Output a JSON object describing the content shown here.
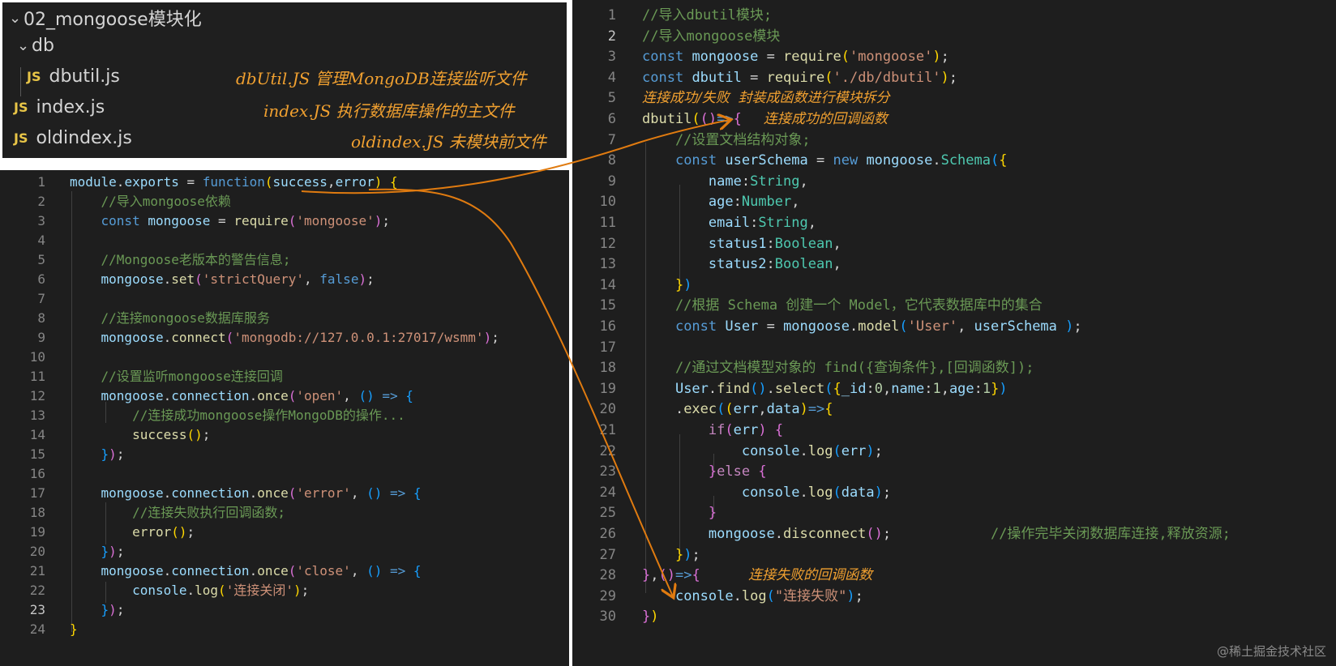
{
  "explorer": {
    "root": "02_mongoose模块化",
    "folder": "db",
    "files": [
      {
        "badge": "JS",
        "name": "dbutil.js",
        "note": "dbUtil.JS 管理MongoDB连接监听文件"
      },
      {
        "badge": "JS",
        "name": "index.js",
        "note": "index.JS  执行数据库操作的主文件"
      },
      {
        "badge": "JS",
        "name": "oldindex.js",
        "note": "oldindex.JS 未模块前文件"
      }
    ]
  },
  "left_editor": {
    "line_numbers": [
      "1",
      "2",
      "3",
      "4",
      "5",
      "6",
      "7",
      "8",
      "9",
      "10",
      "11",
      "12",
      "13",
      "14",
      "15",
      "16",
      "17",
      "18",
      "19",
      "20",
      "21",
      "22",
      "23",
      "24"
    ],
    "active_line": 23,
    "lines": [
      [
        [
          "module",
          "var"
        ],
        [
          ".",
          "pn"
        ],
        [
          "exports",
          "var"
        ],
        [
          " = ",
          "pn"
        ],
        [
          "function",
          "kw"
        ],
        [
          "(",
          "b1"
        ],
        [
          "success",
          "var"
        ],
        [
          ",",
          "pn"
        ],
        [
          "error",
          "var"
        ],
        [
          ")",
          "b1"
        ],
        [
          " ",
          "pn"
        ],
        [
          "{",
          "b1"
        ]
      ],
      [
        [
          "    //导入mongoose依赖",
          "cm"
        ]
      ],
      [
        [
          "    ",
          "pn"
        ],
        [
          "const",
          "kw"
        ],
        [
          " ",
          "pn"
        ],
        [
          "mongoose",
          "var"
        ],
        [
          " = ",
          "pn"
        ],
        [
          "require",
          "fn"
        ],
        [
          "(",
          "b2"
        ],
        [
          "'mongoose'",
          "str"
        ],
        [
          ")",
          "b2"
        ],
        [
          ";",
          "pn"
        ]
      ],
      [
        [
          "",
          "pn"
        ]
      ],
      [
        [
          "    //Mongoose老版本的警告信息;",
          "cm"
        ]
      ],
      [
        [
          "    ",
          "pn"
        ],
        [
          "mongoose",
          "var"
        ],
        [
          ".",
          "pn"
        ],
        [
          "set",
          "fn"
        ],
        [
          "(",
          "b2"
        ],
        [
          "'strictQuery'",
          "str"
        ],
        [
          ", ",
          "pn"
        ],
        [
          "false",
          "kw"
        ],
        [
          ")",
          "b2"
        ],
        [
          ";",
          "pn"
        ]
      ],
      [
        [
          "",
          "pn"
        ]
      ],
      [
        [
          "    //连接mongoose数据库服务",
          "cm"
        ]
      ],
      [
        [
          "    ",
          "pn"
        ],
        [
          "mongoose",
          "var"
        ],
        [
          ".",
          "pn"
        ],
        [
          "connect",
          "fn"
        ],
        [
          "(",
          "b2"
        ],
        [
          "'mongodb://127.0.0.1:27017/wsmm'",
          "str"
        ],
        [
          ")",
          "b2"
        ],
        [
          ";",
          "pn"
        ]
      ],
      [
        [
          "",
          "pn"
        ]
      ],
      [
        [
          "    //设置监听mongoose连接回调",
          "cm"
        ]
      ],
      [
        [
          "    ",
          "pn"
        ],
        [
          "mongoose",
          "var"
        ],
        [
          ".",
          "pn"
        ],
        [
          "connection",
          "var"
        ],
        [
          ".",
          "pn"
        ],
        [
          "once",
          "fn"
        ],
        [
          "(",
          "b2"
        ],
        [
          "'open'",
          "str"
        ],
        [
          ", ",
          "pn"
        ],
        [
          "()",
          "b3"
        ],
        [
          " => ",
          "kw"
        ],
        [
          "{",
          "b3"
        ]
      ],
      [
        [
          "        //连接成功mongoose操作MongoDB的操作...",
          "cm"
        ]
      ],
      [
        [
          "        ",
          "pn"
        ],
        [
          "success",
          "fn"
        ],
        [
          "()",
          "b1"
        ],
        [
          ";",
          "pn"
        ]
      ],
      [
        [
          "    ",
          "pn"
        ],
        [
          "}",
          "b3"
        ],
        [
          ")",
          "b2"
        ],
        [
          ";",
          "pn"
        ]
      ],
      [
        [
          "",
          "pn"
        ]
      ],
      [
        [
          "    ",
          "pn"
        ],
        [
          "mongoose",
          "var"
        ],
        [
          ".",
          "pn"
        ],
        [
          "connection",
          "var"
        ],
        [
          ".",
          "pn"
        ],
        [
          "once",
          "fn"
        ],
        [
          "(",
          "b2"
        ],
        [
          "'error'",
          "str"
        ],
        [
          ", ",
          "pn"
        ],
        [
          "()",
          "b3"
        ],
        [
          " => ",
          "kw"
        ],
        [
          "{",
          "b3"
        ]
      ],
      [
        [
          "        //连接失败执行回调函数;",
          "cm"
        ]
      ],
      [
        [
          "        ",
          "pn"
        ],
        [
          "error",
          "fn"
        ],
        [
          "()",
          "b1"
        ],
        [
          ";",
          "pn"
        ]
      ],
      [
        [
          "    ",
          "pn"
        ],
        [
          "}",
          "b3"
        ],
        [
          ")",
          "b2"
        ],
        [
          ";",
          "pn"
        ]
      ],
      [
        [
          "    ",
          "pn"
        ],
        [
          "mongoose",
          "var"
        ],
        [
          ".",
          "pn"
        ],
        [
          "connection",
          "var"
        ],
        [
          ".",
          "pn"
        ],
        [
          "once",
          "fn"
        ],
        [
          "(",
          "b2"
        ],
        [
          "'close'",
          "str"
        ],
        [
          ", ",
          "pn"
        ],
        [
          "()",
          "b3"
        ],
        [
          " => ",
          "kw"
        ],
        [
          "{",
          "b3"
        ]
      ],
      [
        [
          "        ",
          "pn"
        ],
        [
          "console",
          "var"
        ],
        [
          ".",
          "pn"
        ],
        [
          "log",
          "fn"
        ],
        [
          "(",
          "b1"
        ],
        [
          "'连接关闭'",
          "str"
        ],
        [
          ")",
          "b1"
        ],
        [
          ";",
          "pn"
        ]
      ],
      [
        [
          "    ",
          "pn"
        ],
        [
          "}",
          "b3"
        ],
        [
          ")",
          "b2"
        ],
        [
          ";",
          "pn"
        ]
      ],
      [
        [
          "}",
          "b1"
        ]
      ]
    ]
  },
  "right_editor": {
    "line_numbers": [
      "1",
      "2",
      "3",
      "4",
      "5",
      "6",
      "7",
      "8",
      "9",
      "10",
      "11",
      "12",
      "13",
      "14",
      "15",
      "16",
      "17",
      "18",
      "19",
      "20",
      "21",
      "22",
      "23",
      "24",
      "25",
      "26",
      "27",
      "28",
      "29",
      "30"
    ],
    "active_line": 2,
    "lines": [
      [
        [
          "//导入dbutil模块;",
          "cm"
        ]
      ],
      [
        [
          "//导入mongoose模块",
          "cm"
        ]
      ],
      [
        [
          "const",
          "kw"
        ],
        [
          " ",
          "pn"
        ],
        [
          "mongoose",
          "var"
        ],
        [
          " = ",
          "pn"
        ],
        [
          "require",
          "fn"
        ],
        [
          "(",
          "b1"
        ],
        [
          "'mongoose'",
          "str"
        ],
        [
          ")",
          "b1"
        ],
        [
          ";",
          "pn"
        ]
      ],
      [
        [
          "const",
          "kw"
        ],
        [
          " ",
          "pn"
        ],
        [
          "dbutil",
          "var"
        ],
        [
          " = ",
          "pn"
        ],
        [
          "require",
          "fn"
        ],
        [
          "(",
          "b1"
        ],
        [
          "'./db/dbutil'",
          "str"
        ],
        [
          ")",
          "b1"
        ],
        [
          ";",
          "pn"
        ]
      ],
      [
        [
          "连接成功/失败  封装成函数进行模块拆分",
          "annot"
        ]
      ],
      [
        [
          "dbutil",
          "fn"
        ],
        [
          "(",
          "b1"
        ],
        [
          "()",
          "b2"
        ],
        [
          "=>",
          "kw"
        ],
        [
          "{",
          "b2"
        ],
        [
          "     连接成功的回调函数",
          "annot"
        ]
      ],
      [
        [
          "    //设置文档结构对象;",
          "cm"
        ]
      ],
      [
        [
          "    ",
          "pn"
        ],
        [
          "const",
          "kw"
        ],
        [
          " ",
          "pn"
        ],
        [
          "userSchema",
          "var"
        ],
        [
          " = ",
          "pn"
        ],
        [
          "new",
          "kw"
        ],
        [
          " ",
          "pn"
        ],
        [
          "mongoose",
          "var"
        ],
        [
          ".",
          "pn"
        ],
        [
          "Schema",
          "type"
        ],
        [
          "(",
          "b3"
        ],
        [
          "{",
          "b1"
        ]
      ],
      [
        [
          "        name",
          "var"
        ],
        [
          ":",
          "pn"
        ],
        [
          "String",
          "type"
        ],
        [
          ",",
          "pn"
        ]
      ],
      [
        [
          "        age",
          "var"
        ],
        [
          ":",
          "pn"
        ],
        [
          "Number",
          "type"
        ],
        [
          ",",
          "pn"
        ]
      ],
      [
        [
          "        email",
          "var"
        ],
        [
          ":",
          "pn"
        ],
        [
          "String",
          "type"
        ],
        [
          ",",
          "pn"
        ]
      ],
      [
        [
          "        status1",
          "var"
        ],
        [
          ":",
          "pn"
        ],
        [
          "Boolean",
          "type"
        ],
        [
          ",",
          "pn"
        ]
      ],
      [
        [
          "        status2",
          "var"
        ],
        [
          ":",
          "pn"
        ],
        [
          "Boolean",
          "type"
        ],
        [
          ",",
          "pn"
        ]
      ],
      [
        [
          "    ",
          "pn"
        ],
        [
          "}",
          "b1"
        ],
        [
          ")",
          "b3"
        ]
      ],
      [
        [
          "    //根据 Schema 创建一个 Model，它代表数据库中的集合",
          "cm"
        ]
      ],
      [
        [
          "    ",
          "pn"
        ],
        [
          "const",
          "kw"
        ],
        [
          " ",
          "pn"
        ],
        [
          "User",
          "var"
        ],
        [
          " = ",
          "pn"
        ],
        [
          "mongoose",
          "var"
        ],
        [
          ".",
          "pn"
        ],
        [
          "model",
          "fn"
        ],
        [
          "(",
          "b3"
        ],
        [
          "'User'",
          "str"
        ],
        [
          ", ",
          "pn"
        ],
        [
          "userSchema",
          "var"
        ],
        [
          " ",
          "pn"
        ],
        [
          ")",
          "b3"
        ],
        [
          ";",
          "pn"
        ]
      ],
      [
        [
          "",
          "pn"
        ]
      ],
      [
        [
          "    //通过文档模型对象的 find({查询条件},[回调函数]);",
          "cm"
        ]
      ],
      [
        [
          "    ",
          "pn"
        ],
        [
          "User",
          "var"
        ],
        [
          ".",
          "pn"
        ],
        [
          "find",
          "fn"
        ],
        [
          "()",
          "b3"
        ],
        [
          ".",
          "pn"
        ],
        [
          "select",
          "fn"
        ],
        [
          "(",
          "b3"
        ],
        [
          "{",
          "b1"
        ],
        [
          "_id",
          "var"
        ],
        [
          ":",
          "pn"
        ],
        [
          "0",
          "num"
        ],
        [
          ",",
          "pn"
        ],
        [
          "name",
          "var"
        ],
        [
          ":",
          "pn"
        ],
        [
          "1",
          "num"
        ],
        [
          ",",
          "pn"
        ],
        [
          "age",
          "var"
        ],
        [
          ":",
          "pn"
        ],
        [
          "1",
          "num"
        ],
        [
          "}",
          "b1"
        ],
        [
          ")",
          "b3"
        ]
      ],
      [
        [
          "    .",
          "pn"
        ],
        [
          "exec",
          "fn"
        ],
        [
          "(",
          "b3"
        ],
        [
          "(",
          "b1"
        ],
        [
          "err",
          "var"
        ],
        [
          ",",
          "pn"
        ],
        [
          "data",
          "var"
        ],
        [
          ")",
          "b1"
        ],
        [
          "=>",
          "kw"
        ],
        [
          "{",
          "b1"
        ]
      ],
      [
        [
          "        ",
          "pn"
        ],
        [
          "if",
          "ctl"
        ],
        [
          "(",
          "b2"
        ],
        [
          "err",
          "var"
        ],
        [
          ")",
          "b2"
        ],
        [
          " ",
          "pn"
        ],
        [
          "{",
          "b2"
        ]
      ],
      [
        [
          "            ",
          "pn"
        ],
        [
          "console",
          "var"
        ],
        [
          ".",
          "pn"
        ],
        [
          "log",
          "fn"
        ],
        [
          "(",
          "b3"
        ],
        [
          "err",
          "var"
        ],
        [
          ")",
          "b3"
        ],
        [
          ";",
          "pn"
        ]
      ],
      [
        [
          "        ",
          "pn"
        ],
        [
          "}",
          "b2"
        ],
        [
          "else",
          "ctl"
        ],
        [
          " ",
          "pn"
        ],
        [
          "{",
          "b2"
        ]
      ],
      [
        [
          "            ",
          "pn"
        ],
        [
          "console",
          "var"
        ],
        [
          ".",
          "pn"
        ],
        [
          "log",
          "fn"
        ],
        [
          "(",
          "b3"
        ],
        [
          "data",
          "var"
        ],
        [
          ")",
          "b3"
        ],
        [
          ";",
          "pn"
        ]
      ],
      [
        [
          "        ",
          "pn"
        ],
        [
          "}",
          "b2"
        ]
      ],
      [
        [
          "        ",
          "pn"
        ],
        [
          "mongoose",
          "var"
        ],
        [
          ".",
          "pn"
        ],
        [
          "disconnect",
          "fn"
        ],
        [
          "()",
          "b2"
        ],
        [
          ";",
          "pn"
        ],
        [
          "            ",
          "pn"
        ],
        [
          "//操作完毕关闭数据库连接,释放资源;",
          "cm"
        ]
      ],
      [
        [
          "    ",
          "pn"
        ],
        [
          "}",
          "b1"
        ],
        [
          ")",
          "b3"
        ],
        [
          ";",
          "pn"
        ]
      ],
      [
        [
          "}",
          "b2"
        ],
        [
          ",",
          "pn"
        ],
        [
          "()",
          "b2"
        ],
        [
          "=>",
          "kw"
        ],
        [
          "{",
          "b2"
        ],
        [
          "           连接失败的回调函数",
          "annot"
        ]
      ],
      [
        [
          "    ",
          "pn"
        ],
        [
          "console",
          "var"
        ],
        [
          ".",
          "pn"
        ],
        [
          "log",
          "fn"
        ],
        [
          "(",
          "b3"
        ],
        [
          "\"连接失败\"",
          "str"
        ],
        [
          ")",
          "b3"
        ],
        [
          ";",
          "pn"
        ]
      ],
      [
        [
          "}",
          "b2"
        ],
        [
          ")",
          "b1"
        ]
      ]
    ]
  },
  "watermark": "@稀土掘金技术社区",
  "colors": {
    "accent_arrow": "#e07b10",
    "annotation": "#f0a030",
    "background": "#1e1e1e"
  }
}
